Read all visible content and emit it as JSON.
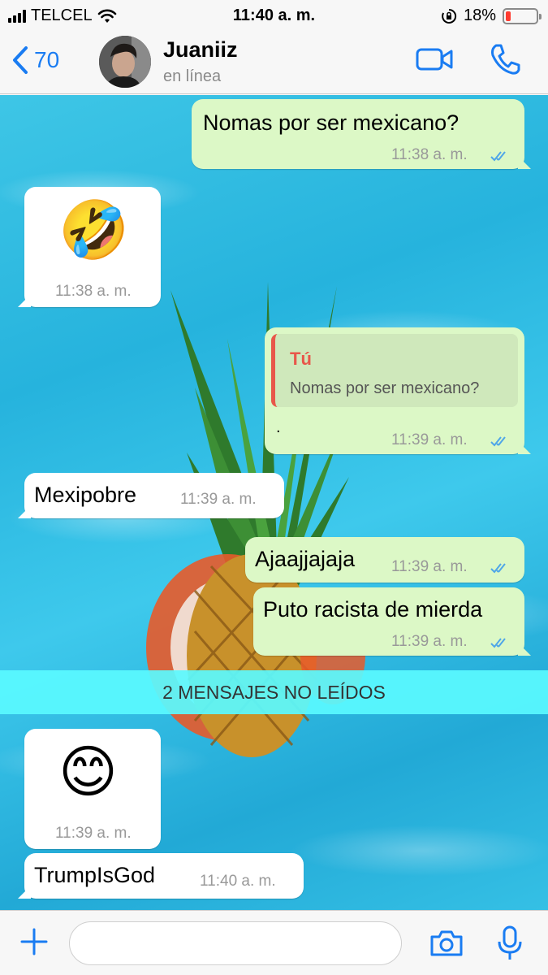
{
  "status_bar": {
    "carrier": "TELCEL",
    "time": "11:40 a. m.",
    "battery_percent": "18%",
    "battery_level": 0.18
  },
  "header": {
    "back_count": "70",
    "contact_name": "Juaniiz",
    "contact_status": "en línea"
  },
  "messages": [
    {
      "direction": "out",
      "text": "Nomas por ser mexicano?",
      "time": "11:38 a. m.",
      "read": true
    },
    {
      "direction": "in",
      "emoji": "🤣",
      "time": "11:38 a. m."
    },
    {
      "direction": "out",
      "quote_author": "Tú",
      "quote_text": "Nomas por ser mexicano?",
      "text": ".",
      "time": "11:39 a. m.",
      "read": true
    },
    {
      "direction": "in",
      "text": "Mexipobre",
      "time": "11:39 a. m."
    },
    {
      "direction": "out",
      "text": "Ajaajjajaja",
      "time": "11:39 a. m.",
      "read": true
    },
    {
      "direction": "out",
      "text": "Puto racista de mierda",
      "time": "11:39 a. m.",
      "read": true
    },
    {
      "direction": "in",
      "emoji": "😊",
      "time": "11:39 a. m."
    },
    {
      "direction": "in",
      "text": "TrumpIsGod",
      "time": "11:40 a. m."
    }
  ],
  "unread_banner": "2 MENSAJES NO LEÍDOS",
  "input": {
    "placeholder": "",
    "value": ""
  },
  "icons": {
    "back": "chevron-left-icon",
    "video": "video-camera-icon",
    "call": "phone-icon",
    "attach": "plus-icon",
    "camera": "camera-icon",
    "mic": "microphone-icon"
  },
  "colors": {
    "accent": "#1a7cf2",
    "outgoing_bubble": "#dcf8c6",
    "incoming_bubble": "#ffffff",
    "read_ticks": "#4fa6e8",
    "quote_author": "#e8574a",
    "battery_low": "#ff3b30",
    "unread_banner": "#5afaff"
  }
}
